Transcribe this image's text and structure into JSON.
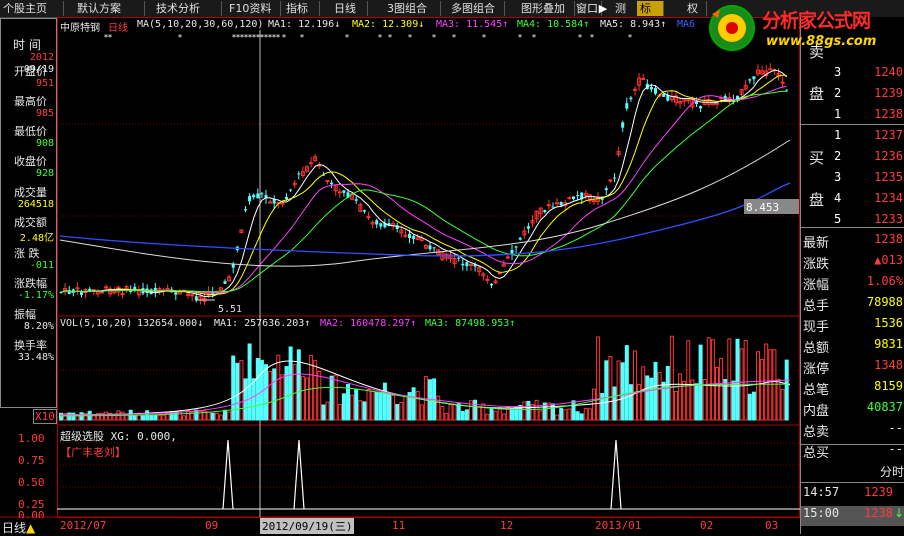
{
  "toolbar": {
    "items": [
      "个股主页",
      "默认方案",
      "技术分析",
      "F10资料",
      "指标",
      "日线",
      "3图组合",
      "多图组合",
      "图形叠加",
      "窗口",
      "▶",
      "测",
      "标",
      "权"
    ]
  },
  "watermark": {
    "title": "分析家公式网",
    "url": "www.88gs.com"
  },
  "stock": {
    "name": "中原特钢",
    "period": "日线",
    "ma_label": "MA(5,10,20,30,60,120)",
    "ma1": "MA1: 12.196↓",
    "ma2": "MA2: 12.309↓",
    "ma3": "MA3: 11.545↑",
    "ma4": "MA4: 10.584↑",
    "ma5": "MA5: 8.943↑",
    "ma6": "MA6"
  },
  "left_panel": {
    "time_label": "时 间",
    "year": "2012",
    "date": "09/19",
    "rows": [
      {
        "label": "开盘价",
        "value": "951",
        "color": "#ff3c3c"
      },
      {
        "label": "最高价",
        "value": "985",
        "color": "#ff3c3c"
      },
      {
        "label": "最低价",
        "value": "908",
        "color": "#3cff3c"
      },
      {
        "label": "收盘价",
        "value": "928",
        "color": "#3cff3c"
      },
      {
        "label": "成交量",
        "value": "264518",
        "color": "#ffff00"
      },
      {
        "label": "成交额",
        "value": "2.48亿",
        "color": "#ffff00"
      },
      {
        "label": "涨 跌",
        "value": "-011",
        "color": "#3cff3c"
      },
      {
        "label": "涨跌幅",
        "value": "-1.17%",
        "color": "#3cff3c"
      },
      {
        "label": "振幅",
        "value": "8.20%",
        "color": "#e8e8e8"
      },
      {
        "label": "换手率",
        "value": "33.48%",
        "color": "#e8e8e8"
      }
    ]
  },
  "chart_annotations": {
    "low_marker": "5.51",
    "price_marker": "8.453",
    "x10": "X10"
  },
  "volume": {
    "label": "VOL(5,10,20)",
    "value": "132654.000↓",
    "ma1": "MA1: 257636.203↑",
    "ma2": "MA2: 160478.297↑",
    "ma3": "MA3: 87498.953↑"
  },
  "indicator": {
    "label": "超级选股 XG: 0.000,",
    "tag": "【广丰老刘】",
    "yticks": [
      "1.00",
      "0.75",
      "0.50",
      "0.25",
      "0.00"
    ],
    "spikes_at": [
      "2012/09",
      "2012/10",
      "2013/02"
    ]
  },
  "bottom": {
    "period_label": "日线",
    "dates": [
      "2012/07",
      "09",
      "2012/09/19(三)",
      "11",
      "12",
      "2013/01",
      "02",
      "03"
    ]
  },
  "right_panel": {
    "sell_label_top": "卖",
    "sell_label": "盘",
    "buy_label_top": "买",
    "buy_label": "盘",
    "sell_orders": [
      {
        "num": "3",
        "price": "1240"
      },
      {
        "num": "2",
        "price": "1239"
      },
      {
        "num": "1",
        "price": "1238"
      }
    ],
    "buy_orders": [
      {
        "num": "1",
        "price": "1237"
      },
      {
        "num": "2",
        "price": "1236"
      },
      {
        "num": "3",
        "price": "1235"
      },
      {
        "num": "4",
        "price": "1234"
      },
      {
        "num": "5",
        "price": "1233"
      }
    ],
    "stats": [
      {
        "label": "最新",
        "value": "1238",
        "color": "#ff3c3c"
      },
      {
        "label": "涨跌",
        "value": "▲013",
        "color": "#ff3c3c"
      },
      {
        "label": "涨幅",
        "value": "1.06%",
        "color": "#ff3c3c"
      },
      {
        "label": "总手",
        "value": "78988",
        "color": "#ffff00"
      },
      {
        "label": "现手",
        "value": "1536",
        "color": "#ffff00"
      },
      {
        "label": "总额",
        "value": "9831",
        "color": "#ffff00"
      },
      {
        "label": "涨停",
        "value": "1348",
        "color": "#ff3c3c"
      },
      {
        "label": "总笔",
        "value": "8159",
        "color": "#ffff00"
      },
      {
        "label": "内盘",
        "value": "40837",
        "color": "#3cff3c"
      },
      {
        "label": "总卖",
        "value": "--",
        "color": "#e8e8e8"
      },
      {
        "label": "总买",
        "value": "--",
        "color": "#e8e8e8"
      }
    ],
    "ticks_header": "分时",
    "ticks": [
      {
        "time": "14:57",
        "price": "1239",
        "arrow": ""
      },
      {
        "time": "15:00",
        "price": "1238",
        "arrow": "↓"
      }
    ]
  }
}
